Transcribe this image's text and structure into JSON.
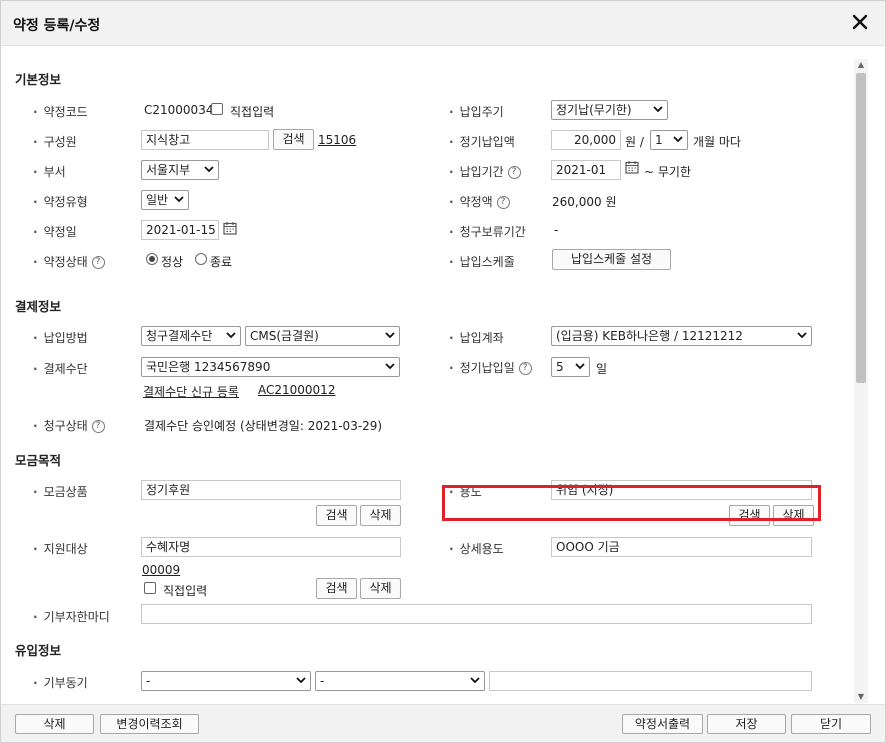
{
  "dialog": {
    "title": "약정 등록/수정"
  },
  "sections": {
    "basic": "기본정보",
    "payment": "결제정보",
    "purpose": "모금목적",
    "inflow": "유입정보"
  },
  "basic": {
    "code_label": "약정코드",
    "code_value": "C21000034",
    "direct_input_label": "직접입력",
    "member_label": "구성원",
    "member_value": "지식창고",
    "search_label": "검색",
    "member_id": "15106",
    "dept_label": "부서",
    "dept_value": "서울지부",
    "type_label": "약정유형",
    "type_value": "일반",
    "date_label": "약정일",
    "date_value": "2021-01-15",
    "status_label": "약정상태",
    "status_normal": "정상",
    "status_end": "종료",
    "cycle_label": "납입주기",
    "cycle_value": "정기납(무기한)",
    "amount_label": "정기납입액",
    "amount_value": "20,000",
    "amount_unit": "원 /",
    "months_value": "1",
    "months_suffix": "개월 마다",
    "period_label": "납입기간",
    "period_start": "2021-01",
    "period_end": "~ 무기한",
    "total_label": "약정액",
    "total_value": "260,000 원",
    "hold_label": "청구보류기간",
    "hold_value": "-",
    "schedule_label": "납입스케줄",
    "schedule_button": "납입스케줄 설정"
  },
  "payment": {
    "method_label": "납입방법",
    "method_value": "청구결제수단",
    "method_sub_value": "CMS(금결원)",
    "means_label": "결제수단",
    "means_value": "국민은행 1234567890",
    "new_means_link": "결제수단 신규 등록",
    "means_code_link": "AC21000012",
    "billing_status_label": "청구상태",
    "billing_status_value": "결제수단 승인예정 (상태변경일: 2021-03-29)",
    "account_label": "납입계좌",
    "account_value": "(입금용) KEB하나은행 / 12121212",
    "pay_day_label": "정기납입일",
    "pay_day_value": "5",
    "pay_day_unit": "일"
  },
  "purpose": {
    "product_label": "모금상품",
    "product_value": "정기후원",
    "search_label": "검색",
    "delete_label": "삭제",
    "use_label": "용도",
    "use_value": "위임 (지정)",
    "target_label": "지원대상",
    "target_value": "수혜자명",
    "target_id": "00009",
    "direct_input_label": "직접입력",
    "detail_use_label": "상세용도",
    "detail_use_value": "OOOO 기금",
    "donor_words_label": "기부자한마디",
    "donor_words_value": ""
  },
  "inflow": {
    "motive_label": "기부동기",
    "motive_value_1": "-",
    "motive_value_2": "-",
    "motive_text": ""
  },
  "footer": {
    "delete": "삭제",
    "history": "변경이력조회",
    "print": "약정서출력",
    "save": "저장",
    "close": "닫기"
  },
  "help_glyph": "?"
}
